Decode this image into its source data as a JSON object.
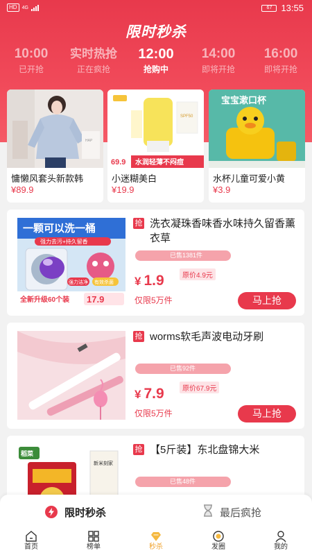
{
  "status_bar": {
    "network": "HD",
    "signal_label": "4G",
    "battery": "67",
    "time": "13:55"
  },
  "page_title": "限时秒杀",
  "time_slots": [
    {
      "time": "10:00",
      "status": "已开抢"
    },
    {
      "time": "实时热抢",
      "status": "正在疯抢"
    },
    {
      "time": "12:00",
      "status": "抢购中"
    },
    {
      "time": "14:00",
      "status": "即将开抢"
    },
    {
      "time": "16:00",
      "status": "即将开抢"
    }
  ],
  "featured": [
    {
      "name": "慵懒风套头新款韩",
      "price": "¥89.9",
      "image": "sweater-photo"
    },
    {
      "name": "小迷糊美白",
      "price": "¥19.9",
      "image": "sunscreen-photo",
      "img_price": "69.9",
      "img_caption": "水润轻薄不闷痘"
    },
    {
      "name": "水杯儿童可爱小黄",
      "price": "¥3.9",
      "image": "duck-cup-photo",
      "img_caption": "宝宝漱口杯"
    }
  ],
  "products": [
    {
      "badge": "抢",
      "name": "洗衣凝珠香味香水味持久留香薰衣草",
      "sold": "已售1381件",
      "currency": "¥",
      "price": "1.9",
      "original": "原价4.9元",
      "limit": "仅限5万件",
      "buy_label": "马上抢",
      "img_title": "一颗可以洗一桶",
      "img_sub": "强力去污+持久留香",
      "img_tags": [
        "强力洁净",
        "有效杀菌"
      ],
      "img_pack": "全新升级60个装",
      "img_price": "17.9"
    },
    {
      "badge": "抢",
      "name": "worms软毛声波电动牙刷",
      "sold": "已售92件",
      "currency": "¥",
      "price": "7.9",
      "original": "原价67.9元",
      "limit": "仅限5万件",
      "buy_label": "马上抢"
    },
    {
      "badge": "抢",
      "name": "【5斤装】东北盘锦大米",
      "sold": "已售48件",
      "currency": "¥",
      "price": "",
      "original": "",
      "limit": "",
      "buy_label": "",
      "img_brand": "稻菜",
      "img_text": "新米刻家"
    }
  ],
  "section_tabs": [
    {
      "label": "限时秒杀",
      "icon": "lightning-icon",
      "active": true
    },
    {
      "label": "最后疯抢",
      "icon": "hourglass-icon",
      "active": false
    }
  ],
  "bottom_nav": [
    {
      "label": "首页",
      "icon": "home-icon"
    },
    {
      "label": "榜单",
      "icon": "grid-icon"
    },
    {
      "label": "秒杀",
      "icon": "diamond-icon",
      "active": true
    },
    {
      "label": "发圈",
      "icon": "circle-icon"
    },
    {
      "label": "我的",
      "icon": "user-icon"
    }
  ],
  "colors": {
    "primary": "#e8394c",
    "nav_active": "#f0a22c",
    "background": "#f2f2f2"
  }
}
